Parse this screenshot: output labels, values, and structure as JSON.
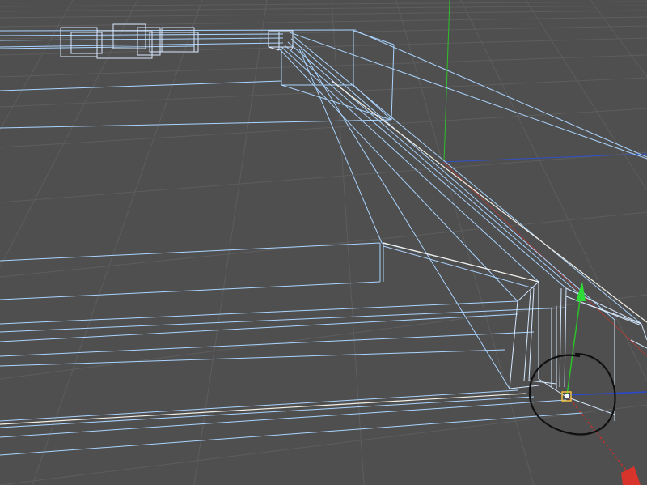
{
  "viewport": {
    "name": "3d-perspective-viewport",
    "background": "#4f4f4f"
  },
  "colors": {
    "floor_grid": "#5b5b5b",
    "floor_grid_dark": "#474747",
    "wire_primary": "#aad4ff",
    "wire_secondary": "#d6e9ff",
    "wire_highlight": "#f2efe6",
    "axis_x": "#c0302c",
    "axis_y": "#2ec02a",
    "axis_z": "#2848d0",
    "annotation": "#101010",
    "pivot": "#f0c040"
  },
  "icons": {
    "move_gizmo_y": "arrow-up-icon",
    "move_gizmo_x": "arrow-cone-icon",
    "pivot": "pivot-handle-icon",
    "annotation": "hand-drawn-circle-icon"
  }
}
